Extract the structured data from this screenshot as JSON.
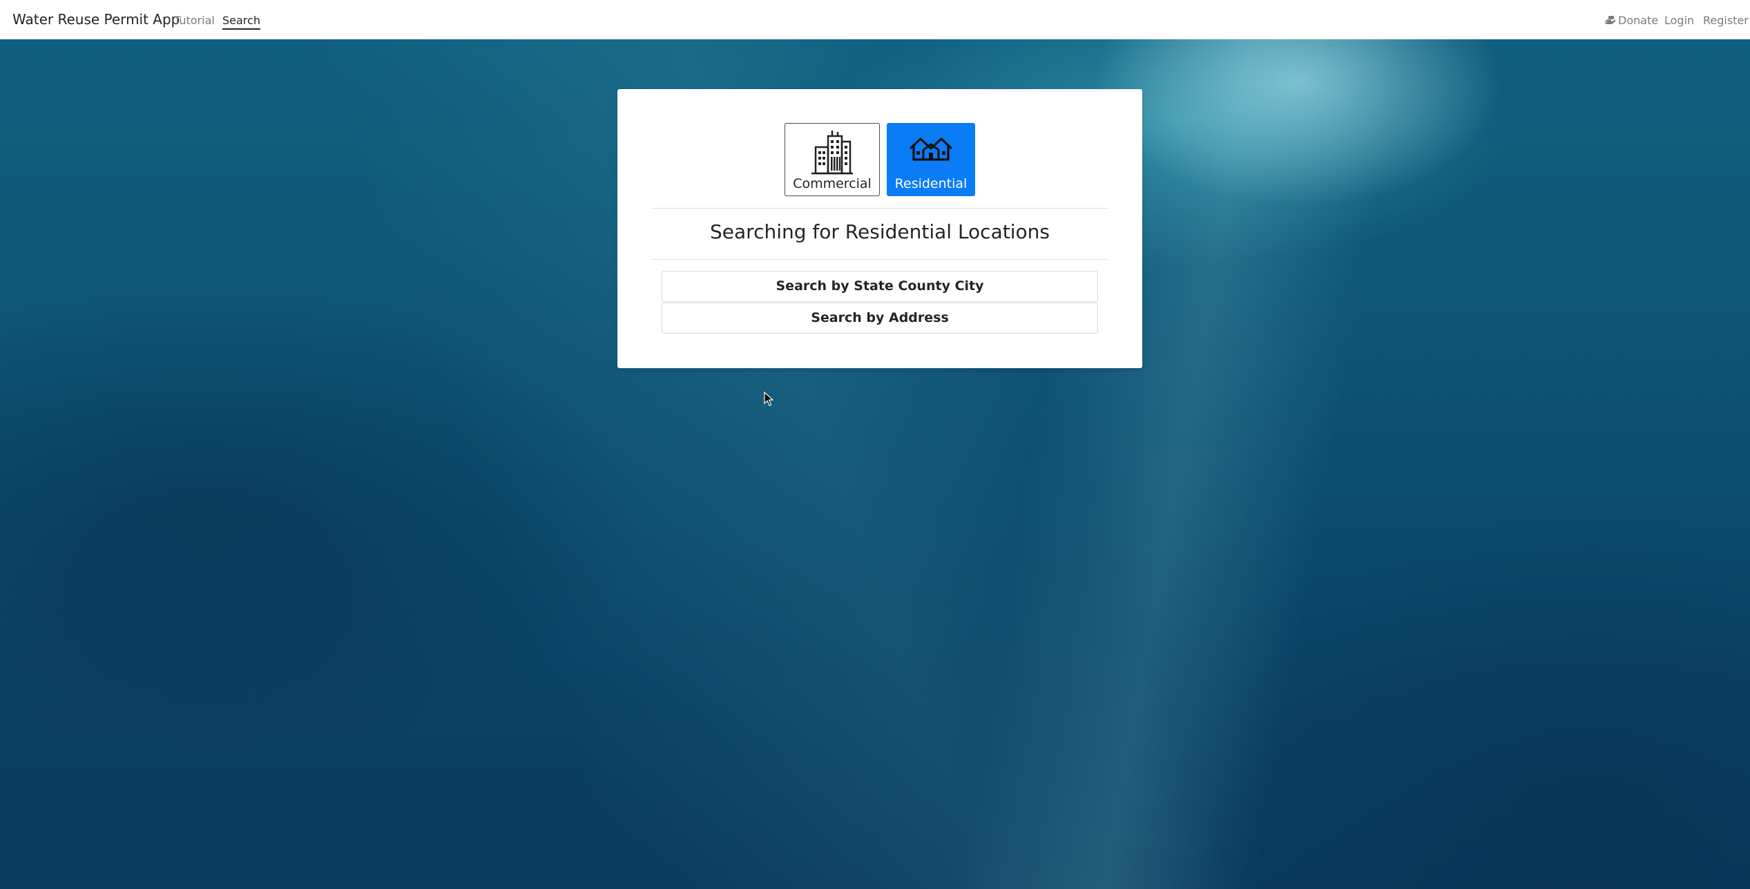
{
  "navbar": {
    "brand": "Water Reuse Permit App",
    "links": [
      {
        "label": "Tutorial",
        "active": false
      },
      {
        "label": "Search",
        "active": true
      }
    ],
    "right": {
      "donate": "Donate",
      "donate_icon": "hand-holding-money-icon",
      "login": "Login",
      "register": "Register"
    }
  },
  "location_types": [
    {
      "label": "Commercial",
      "icon": "office-buildings-icon",
      "selected": false
    },
    {
      "label": "Residential",
      "icon": "houses-icon",
      "selected": true
    }
  ],
  "heading": "Searching for Residential Locations",
  "search_options": [
    "Search by State County City",
    "Search by Address"
  ],
  "colors": {
    "accent": "#0a7cf5",
    "background": "#0c4d70"
  }
}
